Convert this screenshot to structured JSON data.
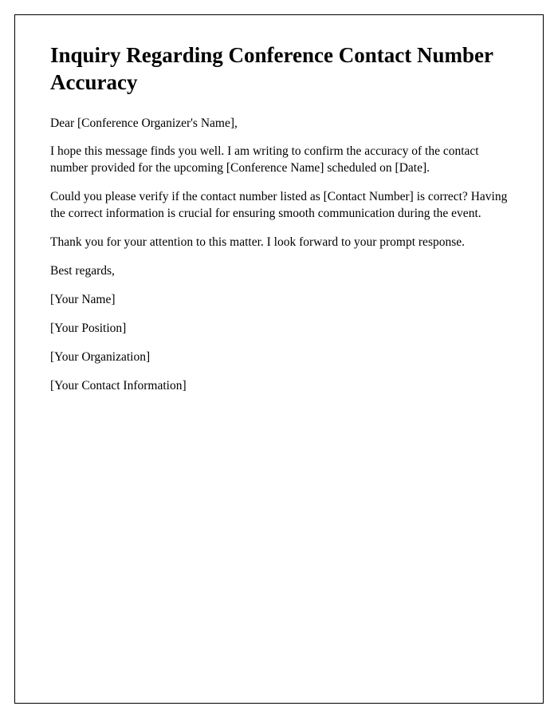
{
  "title": "Inquiry Regarding Conference Contact Number Accuracy",
  "greeting": "Dear [Conference Organizer's Name],",
  "paragraphs": {
    "p1": "I hope this message finds you well. I am writing to confirm the accuracy of the contact number provided for the upcoming [Conference Name] scheduled on [Date].",
    "p2": "Could you please verify if the contact number listed as [Contact Number] is correct? Having the correct information is crucial for ensuring smooth communication during the event.",
    "p3": "Thank you for your attention to this matter. I look forward to your prompt response."
  },
  "closing": "Best regards,",
  "signature": {
    "name": "[Your Name]",
    "position": "[Your Position]",
    "organization": "[Your Organization]",
    "contact": "[Your Contact Information]"
  }
}
